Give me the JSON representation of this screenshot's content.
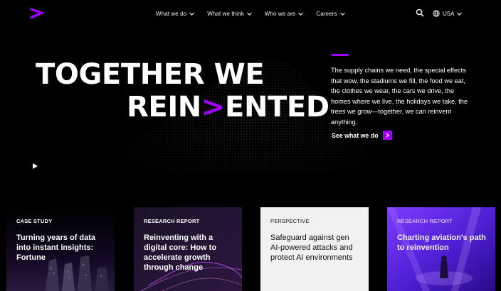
{
  "header": {
    "nav": [
      {
        "label": "What we do"
      },
      {
        "label": "What we think"
      },
      {
        "label": "Who we are"
      },
      {
        "label": "Careers"
      }
    ],
    "region_label": "USA"
  },
  "hero": {
    "title_line1": "TOGETHER WE",
    "title_line2_prefix": "REIN",
    "title_line2_mark": ">",
    "title_line2_suffix": "ENTED",
    "description": "The supply chains we need, the special effects that wow, the stadiums we fill, the food we eat, the clothes we wear, the cars we drive, the homes where we live, the holidays we take, the trees we grow—together, we can reinvent anything.",
    "cta_label": "See what we do"
  },
  "cards": [
    {
      "eyebrow": "CASE STUDY",
      "title": "Turning years of data into instant insights: Fortune"
    },
    {
      "eyebrow": "RESEARCH REPORT",
      "title": "Reinventing with a digital core: How to accelerate growth through change"
    },
    {
      "eyebrow": "PERSPECTIVE",
      "title": "Safeguard against gen AI-powered attacks and protect AI environments"
    },
    {
      "eyebrow": "RESEARCH REPORT",
      "title": "Charting aviation's path to reinvention"
    }
  ],
  "colors": {
    "accent": "#a100ff",
    "background": "#000000",
    "card_light": "#f1f1ef",
    "card_purple": "#5f2cff"
  },
  "icons": {
    "logo": "accenture-logo-icon",
    "search": "search-icon",
    "globe": "globe-icon",
    "chevron": "chevron-down-icon",
    "play": "play-icon",
    "arrow": "arrow-right-icon"
  }
}
